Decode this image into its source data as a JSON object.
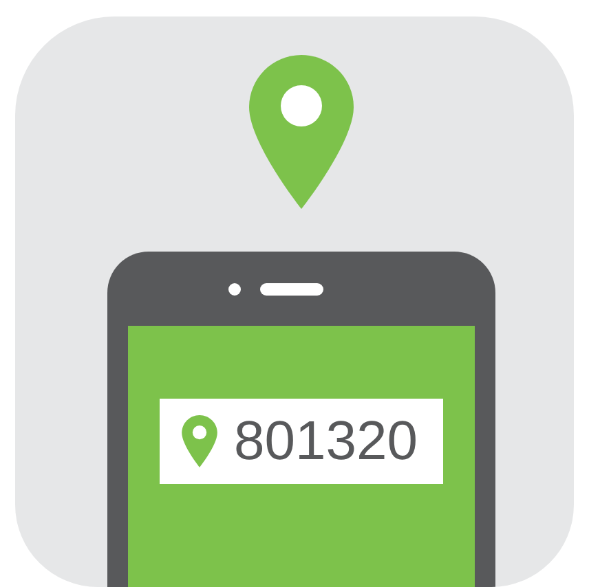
{
  "code_label": {
    "text": "801320"
  }
}
